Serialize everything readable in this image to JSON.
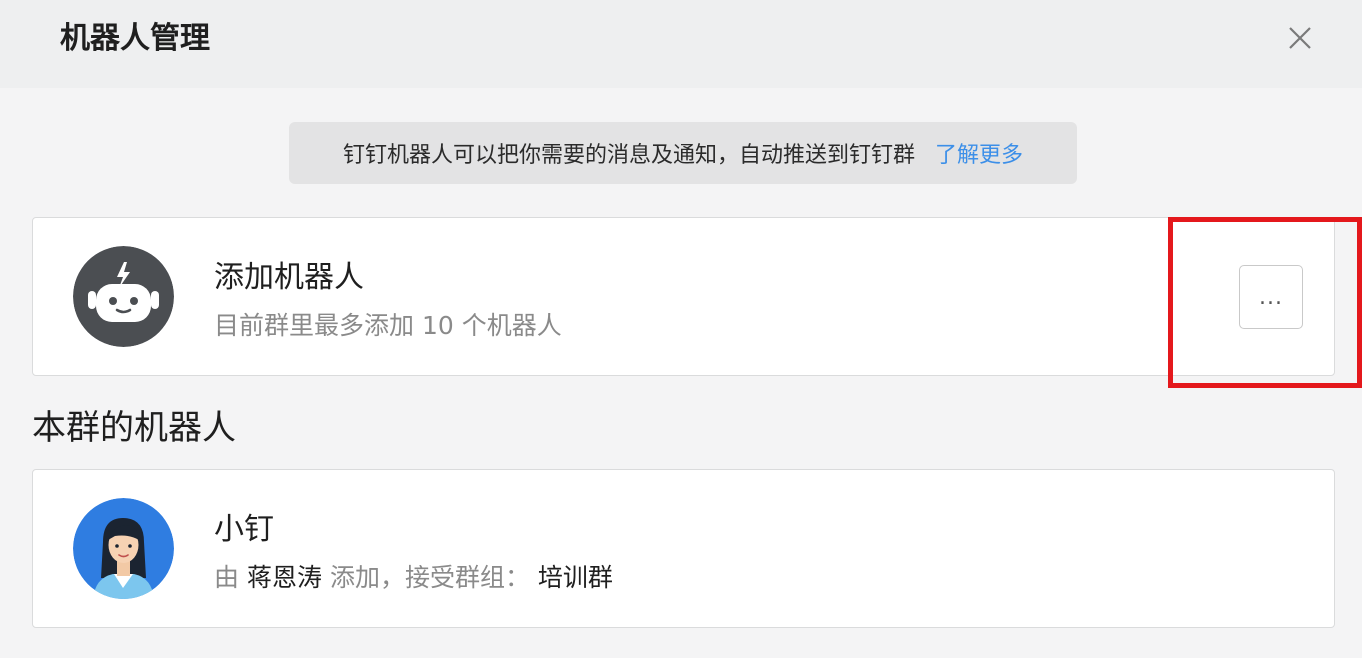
{
  "header": {
    "title": "机器人管理",
    "close_icon": "close-icon"
  },
  "notice": {
    "text": "钉钉机器人可以把你需要的消息及通知，自动推送到钉钉群",
    "link": "了解更多"
  },
  "add_robot": {
    "title": "添加机器人",
    "subtitle": "目前群里最多添加 10 个机器人",
    "more_label": "...",
    "avatar_icon": "robot-icon"
  },
  "group_robots": {
    "section_title": "本群的机器人",
    "items": [
      {
        "name": "小钉",
        "by_prefix": "由",
        "added_by": "蒋恩涛",
        "added_mid": "添加，接受群组：",
        "group": "培训群",
        "avatar_icon": "female-avatar-icon"
      }
    ]
  },
  "colors": {
    "accent_link": "#3c8fe8",
    "highlight": "#e4181c",
    "robot_avatar_bg": "#4b4e52",
    "user_avatar_bg": "#2f7de1"
  }
}
